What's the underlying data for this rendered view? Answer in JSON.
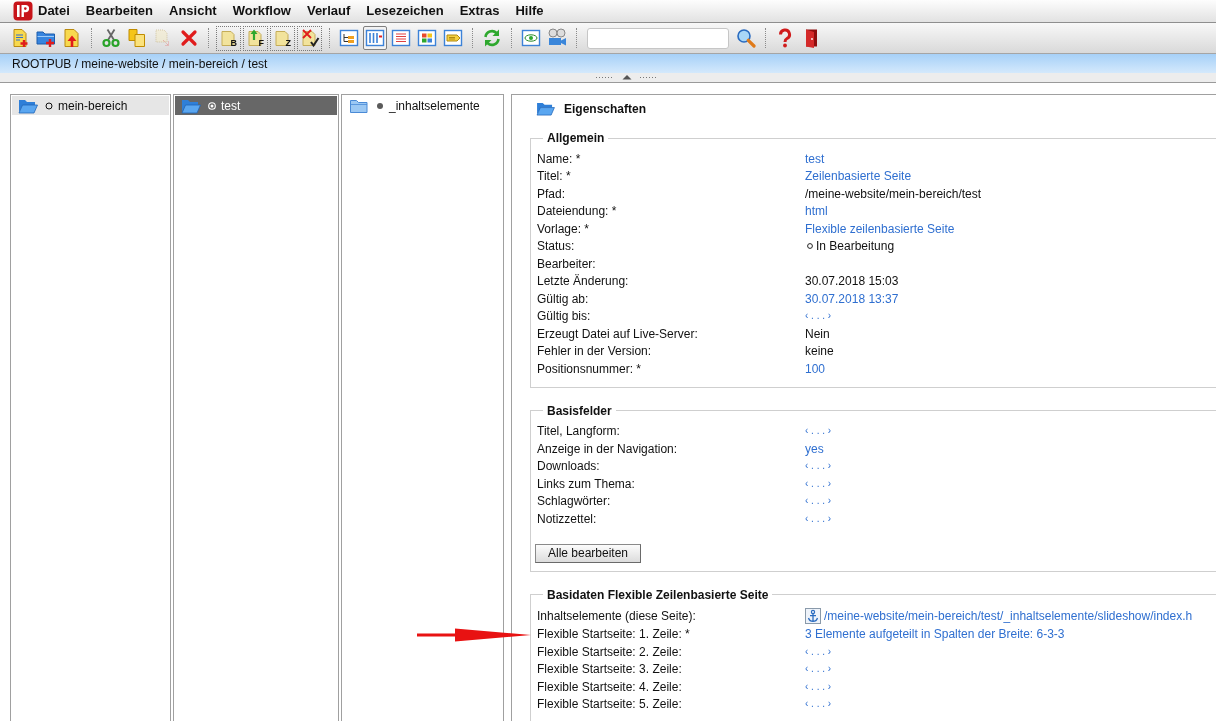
{
  "menu": {
    "items": [
      "Datei",
      "Bearbeiten",
      "Ansicht",
      "Workflow",
      "Verlauf",
      "Lesezeichen",
      "Extras",
      "Hilfe"
    ]
  },
  "toolbar": {
    "groups": [
      {
        "framed": false,
        "items": [
          {
            "kind": "new-page",
            "disabled": false
          },
          {
            "kind": "new-folder",
            "disabled": false
          },
          {
            "kind": "upload",
            "disabled": false
          }
        ]
      },
      {
        "framed": false,
        "items": [
          {
            "kind": "cut",
            "disabled": false
          },
          {
            "kind": "copy",
            "disabled": false
          },
          {
            "kind": "paste",
            "disabled": true
          },
          {
            "kind": "delete",
            "disabled": false
          }
        ]
      },
      {
        "framed": true,
        "items": [
          {
            "kind": "doc-letter",
            "letter": "B",
            "disabled": false
          },
          {
            "kind": "doc-arrow",
            "letter": "F",
            "disabled": false
          },
          {
            "kind": "doc-letter",
            "letter": "Z",
            "disabled": false
          },
          {
            "kind": "doc-x",
            "disabled": false
          }
        ]
      },
      {
        "framed": false,
        "items": [
          {
            "kind": "view-tree",
            "disabled": false,
            "selected": false
          },
          {
            "kind": "view-columns",
            "disabled": false,
            "selected": true
          },
          {
            "kind": "view-list",
            "disabled": false,
            "selected": false
          },
          {
            "kind": "view-tiles",
            "disabled": false,
            "selected": false
          },
          {
            "kind": "view-tags",
            "disabled": false,
            "selected": false
          }
        ]
      },
      {
        "framed": false,
        "items": [
          {
            "kind": "refresh",
            "disabled": false
          }
        ]
      },
      {
        "framed": false,
        "items": [
          {
            "kind": "preview",
            "disabled": false
          },
          {
            "kind": "preview-film",
            "disabled": false
          }
        ]
      },
      {
        "framed": false,
        "items": [
          {
            "kind": "search-field",
            "disabled": false
          },
          {
            "kind": "search",
            "disabled": false
          }
        ]
      },
      {
        "framed": false,
        "items": [
          {
            "kind": "help",
            "disabled": false
          },
          {
            "kind": "exit",
            "disabled": false
          }
        ]
      }
    ]
  },
  "breadcrumb": "ROOTPUB / meine-website / mein-bereich / test",
  "columns": [
    {
      "items": [
        {
          "label": "mein-bereich",
          "kind": "hollow",
          "expanded": true,
          "selected": false
        }
      ]
    },
    {
      "items": [
        {
          "label": "test",
          "kind": "target",
          "expanded": true,
          "selected": true
        }
      ]
    },
    {
      "items": [
        {
          "label": "_inhaltselemente",
          "kind": "solid",
          "expanded": false,
          "selected": false
        }
      ]
    }
  ],
  "properties": {
    "title": "Eigenschaften",
    "sections": [
      {
        "title": "Allgemein",
        "rows": [
          {
            "label": "Name: *",
            "kind": "link",
            "value": "test"
          },
          {
            "label": "Titel: *",
            "kind": "link",
            "value": "Zeilenbasierte Seite"
          },
          {
            "label": "Pfad:",
            "kind": "text",
            "value": "/meine-website/mein-bereich/test"
          },
          {
            "label": "Dateiendung: *",
            "kind": "link",
            "value": "html"
          },
          {
            "label": "Vorlage: *",
            "kind": "link",
            "value": "Flexible zeilenbasierte Seite"
          },
          {
            "label": "Status:",
            "kind": "status",
            "value": "In Bearbeitung"
          },
          {
            "label": "Bearbeiter:",
            "kind": "empty"
          },
          {
            "label": "Letzte Änderung:",
            "kind": "text",
            "value": "30.07.2018 15:03"
          },
          {
            "label": "Gültig ab:",
            "kind": "link",
            "value": "30.07.2018 13:37"
          },
          {
            "label": "Gültig bis:",
            "kind": "placeholder",
            "value": "‹ . . . ›"
          },
          {
            "label": "Erzeugt Datei auf Live-Server:",
            "kind": "text",
            "value": "Nein"
          },
          {
            "label": "Fehler in der Version:",
            "kind": "text",
            "value": "keine"
          },
          {
            "label": "Positionsnummer: *",
            "kind": "link",
            "value": "100"
          }
        ]
      },
      {
        "title": "Basisfelder",
        "rows": [
          {
            "label": "Titel, Langform:",
            "kind": "placeholder",
            "value": "‹ . . . ›"
          },
          {
            "label": "Anzeige in der Navigation:",
            "kind": "link",
            "value": "yes"
          },
          {
            "label": "Downloads:",
            "kind": "placeholder",
            "value": "‹ . . . ›"
          },
          {
            "label": "Links zum Thema:",
            "kind": "placeholder",
            "value": "‹ . . . ›"
          },
          {
            "label": "Schlagwörter:",
            "kind": "placeholder",
            "value": "‹ . . . ›"
          },
          {
            "label": "Notizzettel:",
            "kind": "placeholder",
            "value": "‹ . . . ›"
          }
        ],
        "button": "Alle bearbeiten"
      },
      {
        "title": "Basidaten Flexible Zeilenbasierte Seite",
        "rows": [
          {
            "label": "Inhaltselemente (diese Seite):",
            "kind": "anchor-link",
            "value": "/meine-website/mein-bereich/test/_inhaltselemente/slideshow/index.h"
          },
          {
            "label": "Flexible Startseite: 1. Zeile: *",
            "kind": "link",
            "value": "3 Elemente aufgeteilt in Spalten der Breite: 6-3-3"
          },
          {
            "label": "Flexible Startseite: 2. Zeile:",
            "kind": "placeholder",
            "value": "‹ . . . ›"
          },
          {
            "label": "Flexible Startseite: 3. Zeile:",
            "kind": "placeholder",
            "value": "‹ . . . ›"
          },
          {
            "label": "Flexible Startseite: 4. Zeile:",
            "kind": "placeholder",
            "value": "‹ . . . ›"
          },
          {
            "label": "Flexible Startseite: 5. Zeile:",
            "kind": "placeholder",
            "value": "‹ . . . ›"
          }
        ]
      }
    ]
  }
}
